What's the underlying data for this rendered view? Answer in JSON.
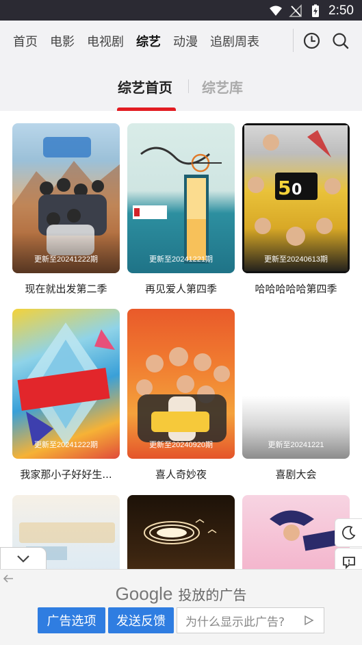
{
  "status": {
    "time": "2:50",
    "icons": [
      "wifi-icon",
      "signal-off-icon",
      "battery-charging-icon"
    ]
  },
  "nav": {
    "tabs": [
      {
        "label": "首页"
      },
      {
        "label": "电影"
      },
      {
        "label": "电视剧"
      },
      {
        "label": "综艺",
        "active": true
      },
      {
        "label": "动漫"
      },
      {
        "label": "追剧周表"
      }
    ],
    "icons": [
      "clock-history-icon",
      "search-icon"
    ]
  },
  "subtabs": [
    {
      "label": "综艺首页",
      "active": true
    },
    {
      "label": "综艺库"
    }
  ],
  "cards": [
    {
      "title": "现在就出发第二季",
      "badge": "更新至20241222期"
    },
    {
      "title": "再见爱人第四季",
      "badge": "更新至20241221期"
    },
    {
      "title": "哈哈哈哈哈第四季",
      "badge": "更新至20240613期"
    },
    {
      "title": "我家那小子好好生...",
      "badge": "更新至20241222期"
    },
    {
      "title": "喜人奇妙夜",
      "badge": "更新至20240920期"
    },
    {
      "title": "喜剧大会",
      "badge": "更新至20241221"
    }
  ],
  "floating": [
    "moon-icon",
    "feedback-icon"
  ],
  "ad": {
    "brand": "Google",
    "label": "投放的广告",
    "options_button": "广告选项",
    "feedback_button": "发送反馈",
    "why_text": "为什么显示此广告?"
  },
  "colors": {
    "accent": "#e21c22",
    "tab_highlight": "#f6d24a",
    "ad_button": "#2f7de1"
  }
}
